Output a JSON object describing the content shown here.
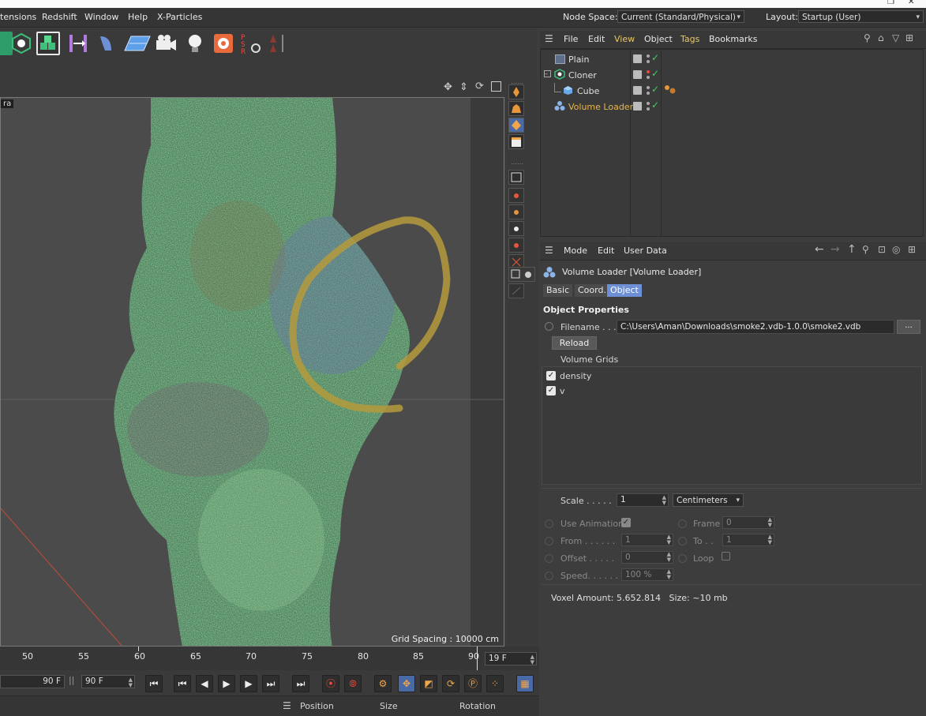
{
  "app": {
    "menu": [
      "tensions",
      "Redshift",
      "Window",
      "Help",
      "X-Particles"
    ],
    "node_space_label": "Node Space:",
    "node_space_value": "Current (Standard/Physical)",
    "layout_label": "Layout:",
    "layout_value": "Startup (User)"
  },
  "viewport": {
    "camera_label": "ra",
    "grid_spacing": "Grid Spacing : 10000 cm"
  },
  "timeline": {
    "ticks": [
      "50",
      "55",
      "60",
      "65",
      "70",
      "75",
      "80",
      "85",
      "90"
    ],
    "current_frame": "19 F"
  },
  "transport": {
    "end_field_a": "90 F",
    "end_field_b": "90 F"
  },
  "coords": {
    "position": "Position",
    "size": "Size",
    "rotation": "Rotation"
  },
  "object_manager": {
    "menu": [
      "File",
      "Edit",
      "View",
      "Object",
      "Tags",
      "Bookmarks"
    ],
    "objects": [
      {
        "name": "Plain",
        "selected": false
      },
      {
        "name": "Cloner",
        "selected": false
      },
      {
        "name": "Cube",
        "selected": false
      },
      {
        "name": "Volume Loader",
        "selected": true
      }
    ]
  },
  "attribute_manager": {
    "menu": [
      "Mode",
      "Edit",
      "User Data"
    ],
    "object_title": "Volume Loader [Volume Loader]",
    "tabs": [
      "Basic",
      "Coord.",
      "Object"
    ],
    "active_tab": "Object",
    "section_title": "Object Properties",
    "filename_label": "Filename . . .",
    "filename_value": "C:\\Users\\Aman\\Downloads\\smoke2.vdb-1.0.0\\smoke2.vdb",
    "browse_label": "...",
    "reload_label": "Reload",
    "volume_grids_label": "Volume Grids",
    "grids": [
      "density",
      "v"
    ],
    "scale_label": "Scale . . . . .",
    "scale_value": "1",
    "scale_unit": "Centimeters",
    "use_animation_label": "Use Animation",
    "frame_label": "Frame",
    "frame_value": "0",
    "from_label": "From . . . . . .",
    "from_value": "1",
    "to_label": "To . .",
    "to_value": "1",
    "offset_label": "Offset . . . . .",
    "offset_value": "0",
    "loop_label": "Loop",
    "speed_label": "Speed. . . . . .",
    "speed_value": "100 %",
    "voxel_info": "Voxel Amount: 5.652.814   Size: ~10 mb"
  },
  "colors": {
    "accent_yellow": "#e8c766",
    "selected_blue": "#6d8fd6",
    "check_green": "#3ad35a",
    "annotation": "#b59a3c"
  }
}
